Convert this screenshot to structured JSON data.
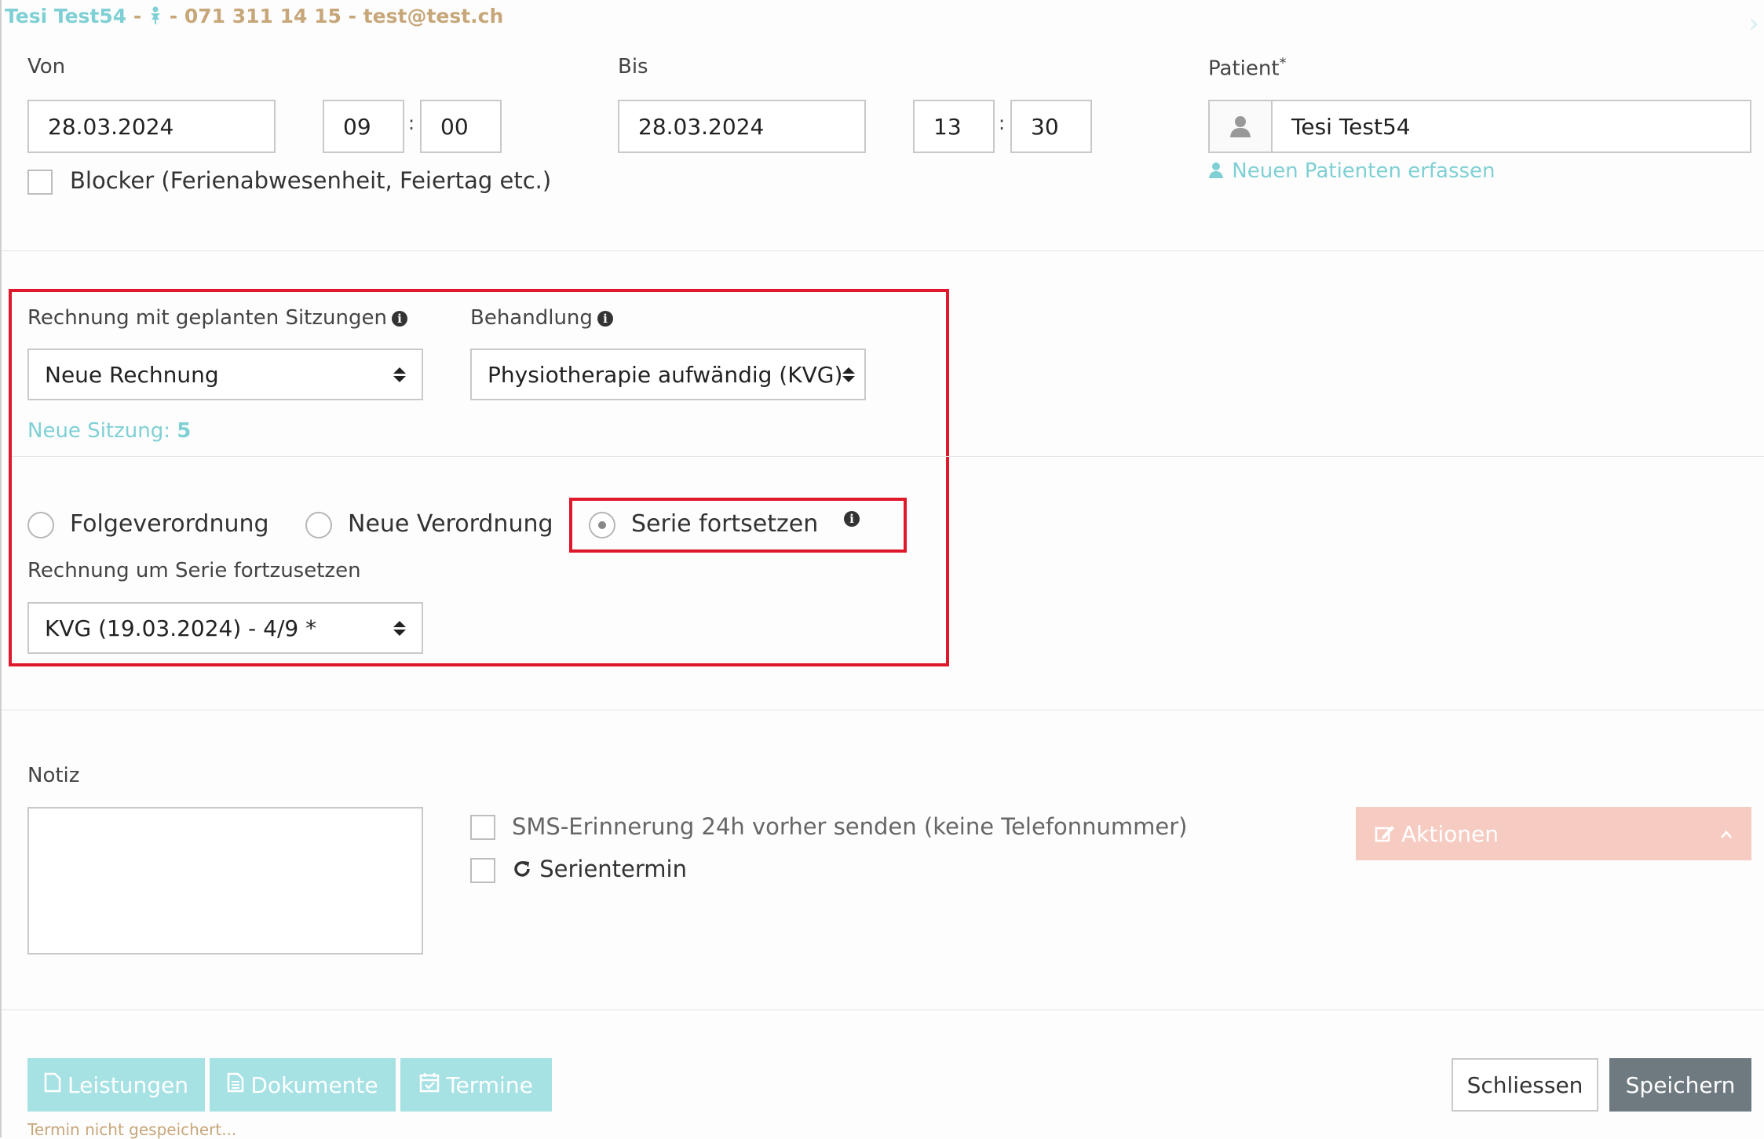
{
  "header": {
    "patient_name": "Tesi Test54",
    "separator": "-",
    "gender_icon": "person-female-icon",
    "phone": "071 311 14 15",
    "email": "test@test.ch"
  },
  "von": {
    "label": "Von",
    "date": "28.03.2024",
    "hour": "09",
    "minute": "00"
  },
  "bis": {
    "label": "Bis",
    "date": "28.03.2024",
    "hour": "13",
    "minute": "30"
  },
  "time_separator": ":",
  "patient": {
    "label": "Patient",
    "required_mark": "*",
    "value": "Tesi Test54",
    "new_patient_link": "Neuen Patienten erfassen"
  },
  "blocker": {
    "label": "Blocker (Ferienabwesenheit, Feiertag etc.)",
    "checked": false
  },
  "rechnung": {
    "label": "Rechnung mit geplanten Sitzungen",
    "selected": "Neue Rechnung",
    "session_label": "Neue Sitzung:",
    "session_number": "5"
  },
  "behandlung": {
    "label": "Behandlung",
    "selected": "Physiotherapie aufwändig (KVG)"
  },
  "verordnung": {
    "options": [
      "Folgeverordnung",
      "Neue Verordnung",
      "Serie fortsetzen"
    ],
    "selected_index": 2
  },
  "serie": {
    "label": "Rechnung um Serie fortzusetzen",
    "selected": "KVG (19.03.2024) - 4/9 *"
  },
  "notiz": {
    "label": "Notiz",
    "value": ""
  },
  "sms": {
    "label": "SMS-Erinnerung 24h vorher senden (keine Telefonnummer)",
    "checked": false
  },
  "serientermin": {
    "label": "Serientermin",
    "checked": false
  },
  "aktionen": {
    "label": "Aktionen"
  },
  "footer": {
    "leistungen": "Leistungen",
    "dokumente": "Dokumente",
    "termine": "Termine",
    "schliessen": "Schliessen",
    "speichern": "Speichern",
    "status": "Termin nicht gespeichert..."
  },
  "colors": {
    "teal": "#7fd0d4",
    "gold": "#c7a77a",
    "highlight_red": "#e0182c",
    "action_bg": "#f6ccc2",
    "save_bg": "#6e7a80"
  }
}
